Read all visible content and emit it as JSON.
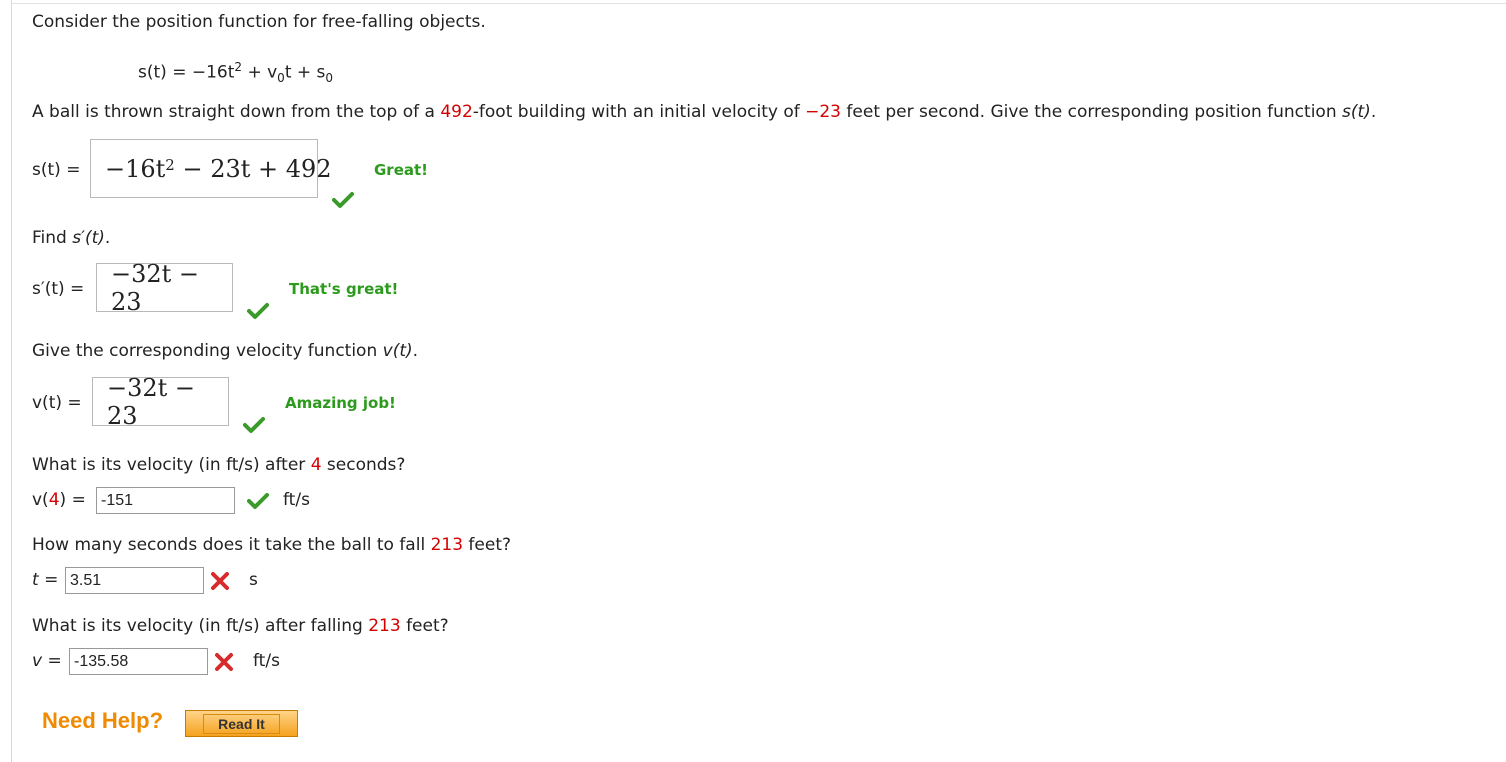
{
  "intro": "Consider the position function for free-falling objects.",
  "formula": {
    "lhs": "s(t)",
    "eq": "=",
    "t1": "−16t",
    "t1_exp": "2",
    "plus1": "+",
    "v": "v",
    "v_sub": "0",
    "t": "t",
    "plus2": "+",
    "s": "s",
    "s_sub": "0"
  },
  "problem": {
    "part1": "A ball is thrown straight down from the top of a ",
    "height": "492",
    "part2": "-foot building with an initial velocity of ",
    "velocity": "−23",
    "part3": " feet per second. Give the corresponding position function ",
    "fn": "s(t)",
    "end": "."
  },
  "q1": {
    "label": "s(t) =",
    "answer_main": "−16t",
    "answer_exp": "2",
    "answer_rest": " − 23t + 492",
    "feedback": "Great!"
  },
  "q2": {
    "prompt_a": "Find ",
    "prompt_fn": "s′(t)",
    "prompt_b": ".",
    "label": "s′(t) =",
    "answer": "−32t − 23",
    "feedback": "That's great!"
  },
  "q3": {
    "prompt_a": "Give the corresponding velocity function ",
    "prompt_fn": "v(t)",
    "prompt_b": ".",
    "label": "v(t) =",
    "answer": "−32t − 23",
    "feedback": "Amazing job!"
  },
  "q4": {
    "prompt_a": "What is its velocity (in ft/s) after ",
    "prompt_num": "4",
    "prompt_b": " seconds?",
    "label_a": "v(",
    "label_num": "4",
    "label_b": ") =",
    "value": "-151",
    "unit": "ft/s",
    "status": "correct"
  },
  "q5": {
    "prompt_a": "How many seconds does it take the ball to fall ",
    "prompt_num": "213",
    "prompt_b": " feet?",
    "label": "t =",
    "value": "3.51",
    "unit": "s",
    "status": "incorrect"
  },
  "q6": {
    "prompt_a": "What is its velocity (in ft/s) after falling ",
    "prompt_num": "213",
    "prompt_b": " feet?",
    "label": "v =",
    "value": "-135.58",
    "unit": "ft/s",
    "status": "incorrect"
  },
  "help": {
    "label": "Need Help?",
    "button": "Read It"
  },
  "colors": {
    "correct": "#2c9a1c",
    "incorrect": "#d40000",
    "highlight": "#d40000",
    "help": "#f08a00"
  },
  "icons": {
    "correct": "check-icon",
    "incorrect": "cross-icon"
  }
}
